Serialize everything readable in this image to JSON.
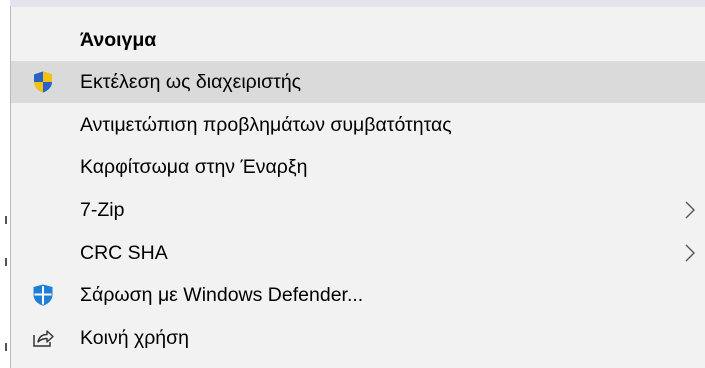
{
  "context_menu": {
    "items": [
      {
        "label": "Άνοιγμα",
        "bold": true
      },
      {
        "label": "Εκτέλεση ως διαχειριστής",
        "icon": "uac-shield-icon",
        "highlighted": true
      },
      {
        "label": "Αντιμετώπιση προβλημάτων συμβατότητας"
      },
      {
        "label": "Καρφίτσωμα στην Έναρξη"
      },
      {
        "label": "7-Zip",
        "submenu": true
      },
      {
        "label": "CRC SHA",
        "submenu": true
      },
      {
        "label": "Σάρωση με Windows Defender...",
        "icon": "windows-defender-icon"
      },
      {
        "label": "Κοινή χρήση",
        "icon": "share-icon"
      }
    ]
  },
  "colors": {
    "menu_background": "#f2f2f2",
    "highlight_background": "#dadada",
    "shield_blue": "#2a63c8",
    "shield_yellow": "#f4c20d",
    "defender_blue": "#1e7fd6"
  }
}
